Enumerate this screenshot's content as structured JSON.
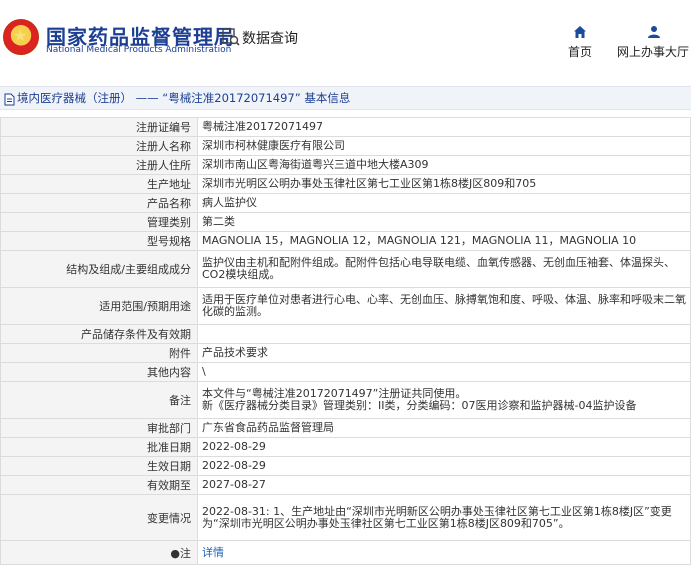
{
  "header": {
    "site_name_cn": "国家药品监督管理局",
    "site_name_en": "National Medical Products Administration",
    "data_query_label": "数据查询",
    "nav_home": "首页",
    "nav_service": "网上办事大厅"
  },
  "title_bar": "境内医疗器械（注册） —— “粤械注准20172071497” 基本信息",
  "rows": [
    {
      "label": "注册证编号",
      "value": "粤械注准20172071497"
    },
    {
      "label": "注册人名称",
      "value": "深圳市柯林健康医疗有限公司"
    },
    {
      "label": "注册人住所",
      "value": "深圳市南山区粤海街道粤兴三道中地大楼A309"
    },
    {
      "label": "生产地址",
      "value": "深圳市光明区公明办事处玉律社区第七工业区第1栋8楼J区809和705"
    },
    {
      "label": "产品名称",
      "value": "病人监护仪"
    },
    {
      "label": "管理类别",
      "value": "第二类"
    },
    {
      "label": "型号规格",
      "value": "MAGNOLIA 15，MAGNOLIA 12，MAGNOLIA 121，MAGNOLIA 11，MAGNOLIA 10"
    },
    {
      "label": "结构及组成/主要组成成分",
      "value": "监护仪由主机和配附件组成。配附件包括心电导联电缆、血氧传感器、无创血压袖套、体温探头、CO2模块组成。"
    },
    {
      "label": "适用范围/预期用途",
      "value": "适用于医疗单位对患者进行心电、心率、无创血压、脉搏氧饱和度、呼吸、体温、脉率和呼吸末二氧化碳的监测。"
    },
    {
      "label": "产品储存条件及有效期",
      "value": ""
    },
    {
      "label": "附件",
      "value": "产品技术要求"
    },
    {
      "label": "其他内容",
      "value": "\\"
    },
    {
      "label": "备注",
      "value": "本文件与“粤械注准20172071497”注册证共同使用。\n新《医疗器械分类目录》管理类别：II类，分类编码：07医用诊察和监护器械-04监护设备"
    },
    {
      "label": "审批部门",
      "value": "广东省食品药品监督管理局"
    },
    {
      "label": "批准日期",
      "value": "2022-08-29"
    },
    {
      "label": "生效日期",
      "value": "2022-08-29"
    },
    {
      "label": "有效期至",
      "value": "2027-08-27"
    },
    {
      "label": "变更情况",
      "value": "2022-08-31: 1、生产地址由“深圳市光明新区公明办事处玉律社区第七工业区第1栋8楼J区”变更为“深圳市光明区公明办事处玉律社区第七工业区第1栋8楼J区809和705”。"
    },
    {
      "label": "注",
      "value": "详情"
    }
  ]
}
